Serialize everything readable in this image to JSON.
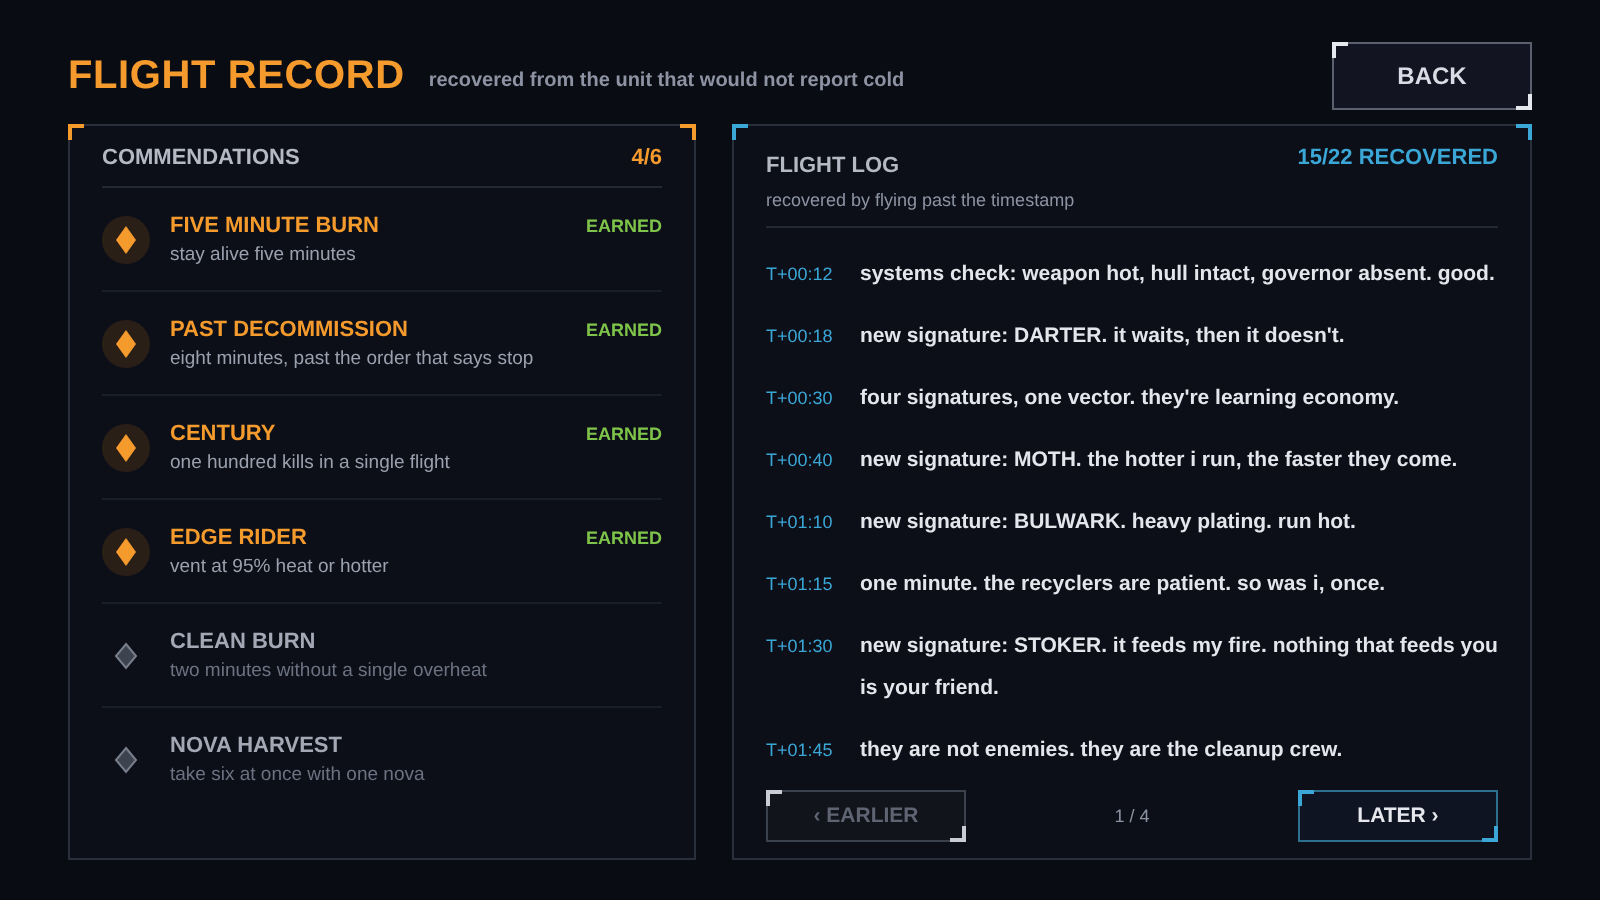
{
  "header": {
    "title": "FLIGHT RECORD",
    "subtitle": "recovered from the unit that would not report cold",
    "back_button": "BACK"
  },
  "commendations": {
    "title": "COMMENDATIONS",
    "count": "4/6",
    "items": [
      {
        "name": "FIVE MINUTE BURN",
        "description": "stay alive five minutes",
        "earned": true,
        "status": "EARNED"
      },
      {
        "name": "PAST DECOMMISSION",
        "description": "eight minutes, past the order that says stop",
        "earned": true,
        "status": "EARNED"
      },
      {
        "name": "CENTURY",
        "description": "one hundred kills in a single flight",
        "earned": true,
        "status": "EARNED"
      },
      {
        "name": "EDGE RIDER",
        "description": "vent at 95% heat or hotter",
        "earned": true,
        "status": "EARNED"
      },
      {
        "name": "CLEAN BURN",
        "description": "two minutes without a single overheat",
        "earned": false
      },
      {
        "name": "NOVA HARVEST",
        "description": "take six at once with one nova",
        "earned": false
      }
    ]
  },
  "flight_log": {
    "title": "FLIGHT LOG",
    "subtitle": "recovered by flying past the timestamp",
    "count": "15/22 RECOVERED",
    "entries": [
      {
        "time": "T+00:12",
        "text": "systems check: weapon hot, hull intact, governor absent. good."
      },
      {
        "time": "T+00:18",
        "text": "new signature: DARTER. it waits, then it doesn't."
      },
      {
        "time": "T+00:30",
        "text": "four signatures, one vector. they're learning economy."
      },
      {
        "time": "T+00:40",
        "text": "new signature: MOTH. the hotter i run, the faster they come."
      },
      {
        "time": "T+01:10",
        "text": "new signature: BULWARK. heavy plating. run hot."
      },
      {
        "time": "T+01:15",
        "text": "one minute. the recyclers are patient. so was i, once."
      },
      {
        "time": "T+01:30",
        "text": "new signature: STOKER. it feeds my fire. nothing that feeds you is your friend."
      },
      {
        "time": "T+01:45",
        "text": "they are not enemies. they are the cleanup crew."
      }
    ],
    "pager": {
      "previous": {
        "label": "‹ EARLIER",
        "disabled": true
      },
      "page": "1 / 4",
      "next": {
        "label": "LATER ›",
        "disabled": false
      }
    }
  }
}
